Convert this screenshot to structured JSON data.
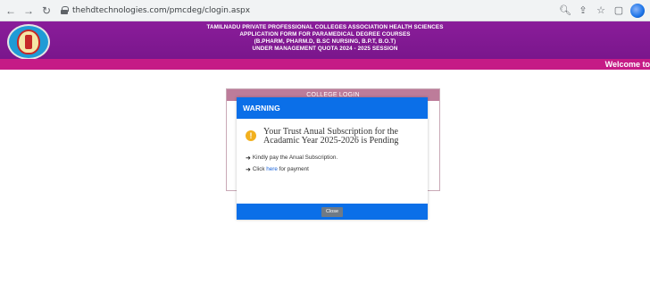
{
  "browser": {
    "url": "thehdtechnologies.com/pmcdeg/clogin.aspx"
  },
  "header": {
    "lines": [
      "TAMILNADU PRIVATE PROFESSIONAL COLLEGES ASSOCIATION HEALTH SCIENCES",
      "APPLICATION FORM FOR PARAMEDICAL DEGREE COURSES",
      "(B.PHARM, PHARM.D, B.SC NURSING, B.P.T, B.O.T)",
      "UNDER MANAGEMENT QUOTA 2024 - 2025 SESSION"
    ],
    "marquee_text": "Welcome to"
  },
  "login": {
    "title": "COLLEGE LOGIN"
  },
  "modal": {
    "title": "WARNING",
    "message_line1": "Your Trust Anual Subscription for the",
    "message_line2": "Acadamic Year 2025-2026 is Pending",
    "bullet1": "Kindly pay the Anual Subscription.",
    "bullet2_prefix": "Click",
    "bullet2_link": "here",
    "bullet2_suffix": "for payment",
    "close_label": "Close"
  },
  "colors": {
    "header_purple": "#7a168c",
    "marquee_magenta": "#c51b86",
    "modal_blue": "#0b6fe8",
    "login_header": "#bd7c9a",
    "warning_icon": "#f2b01e"
  }
}
